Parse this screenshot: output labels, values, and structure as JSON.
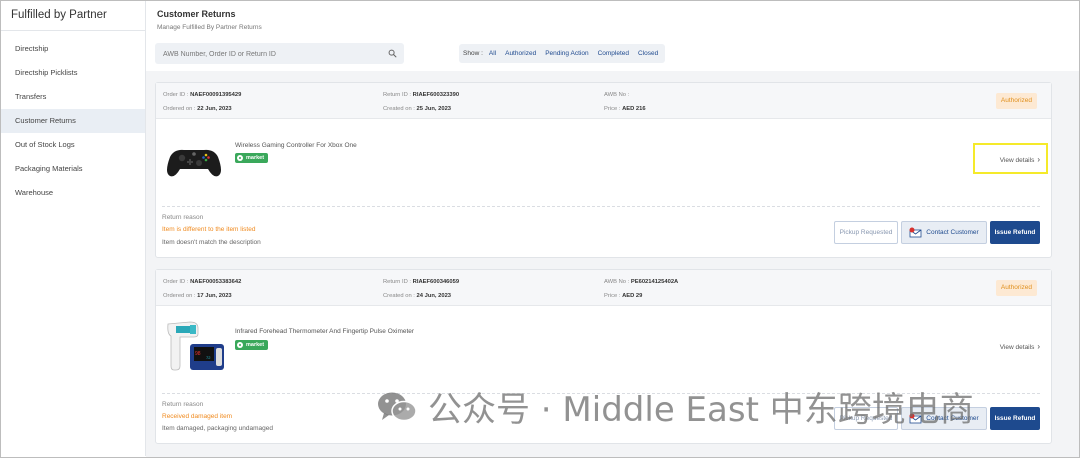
{
  "sidebar": {
    "title": "Fulfilled by Partner",
    "items": [
      {
        "label": "Directship"
      },
      {
        "label": "Directship Picklists"
      },
      {
        "label": "Transfers"
      },
      {
        "label": "Customer Returns"
      },
      {
        "label": "Out of Stock Logs"
      },
      {
        "label": "Packaging Materials"
      },
      {
        "label": "Warehouse"
      }
    ],
    "active": "Customer Returns"
  },
  "header": {
    "title": "Customer Returns",
    "subtitle": "Manage Fulfilled By Partner Returns"
  },
  "search": {
    "placeholder": "AWB Number, Order ID or Return ID",
    "value": ""
  },
  "filters": {
    "label": "Show :",
    "options": [
      "All",
      "Authorized",
      "Pending Action",
      "Completed",
      "Closed"
    ]
  },
  "returns": [
    {
      "order_id_label": "Order ID :",
      "order_id": "NAEF00091395429",
      "ordered_on_label": "Ordered on :",
      "ordered_on": "22 Jun, 2023",
      "return_id_label": "Return ID :",
      "return_id": "RIAEF600323390",
      "created_on_label": "Created on :",
      "created_on": "25 Jun, 2023",
      "awb_label": "AWB No :",
      "awb": "",
      "price_label": "Price :",
      "price": "AED 216",
      "status": "Authorized",
      "product_name": "Wireless Gaming Controller For Xbox One",
      "market_tag": "market",
      "view_details": "View details",
      "return_reason_label": "Return reason",
      "return_reason": "Item is different to the item listed",
      "return_description": "Item doesn't match the description",
      "btn_pickup": "Pickup Requested",
      "btn_contact": "Contact Customer",
      "btn_refund": "Issue Refund"
    },
    {
      "order_id_label": "Order ID :",
      "order_id": "NAEF00053383642",
      "ordered_on_label": "Ordered on :",
      "ordered_on": "17 Jun, 2023",
      "return_id_label": "Return ID :",
      "return_id": "RIAEF600346059",
      "created_on_label": "Created on :",
      "created_on": "24 Jun, 2023",
      "awb_label": "AWB No :",
      "awb": "PE60214125402A",
      "price_label": "Price :",
      "price": "AED 29",
      "status": "Authorized",
      "product_name": "Infrared Forehead Thermometer And Fingertip Pulse Oximeter",
      "market_tag": "market",
      "view_details": "View details",
      "return_reason_label": "Return reason",
      "return_reason": "Received damaged item",
      "return_description": "Item damaged, packaging undamaged",
      "btn_pickup": "Pickup Requested",
      "btn_contact": "Contact Customer",
      "btn_refund": "Issue Refund"
    }
  ],
  "watermark": {
    "text": "公众号 · Middle East 中东跨境电商"
  }
}
